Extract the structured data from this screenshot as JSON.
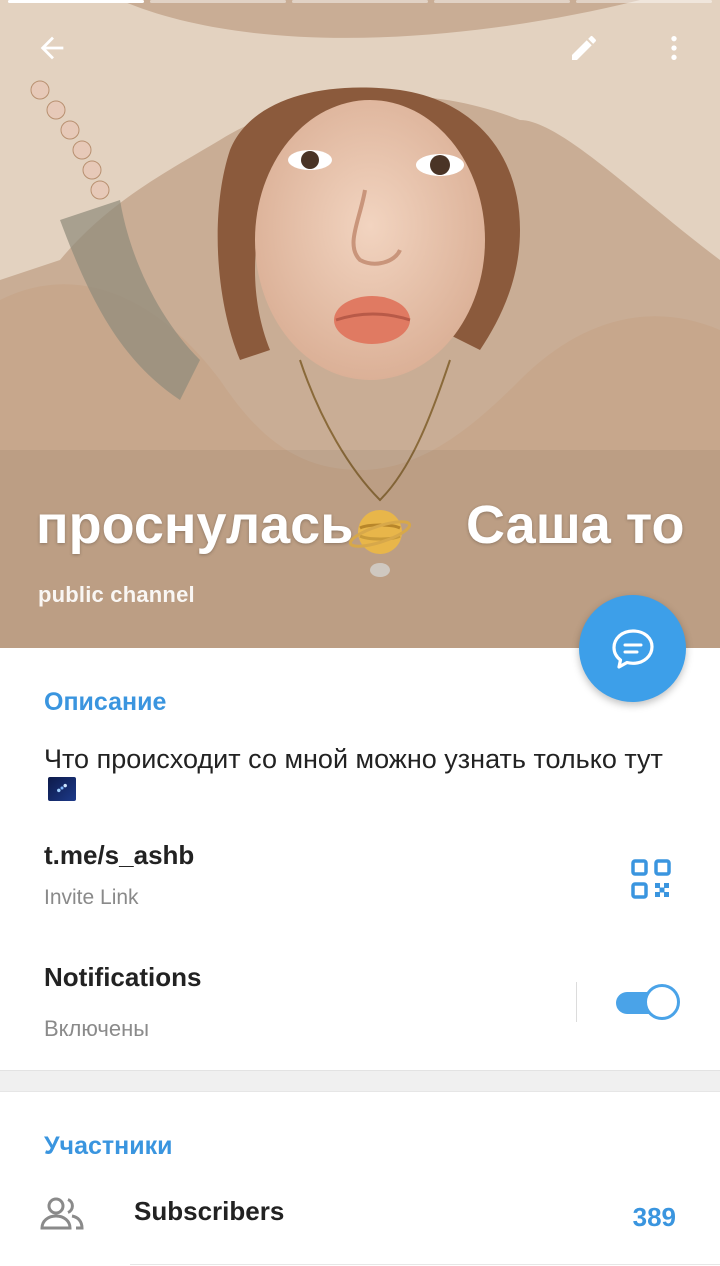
{
  "header": {
    "title_left": "проснулась",
    "title_right": "Саша то",
    "status": "public channel",
    "icons": {
      "back": "arrow-left-icon",
      "edit": "pencil-icon",
      "more": "more-vertical-icon",
      "fab": "chat-bubble-icon",
      "planet": "ringed-planet-emoji"
    }
  },
  "info": {
    "description_title": "Описание",
    "description_text": "Что происходит со мной можно узнать только тут",
    "link": "t.me/s_ashb",
    "link_sub": "Invite Link",
    "notifications_label": "Notifications",
    "notifications_state": "Включены",
    "notifications_on": true
  },
  "members": {
    "title": "Участники",
    "subscribers_label": "Subscribers",
    "subscribers_count": "389"
  },
  "colors": {
    "accent": "#3a95df",
    "fab": "#3d9fe9",
    "toggle": "#4aa3e8"
  }
}
